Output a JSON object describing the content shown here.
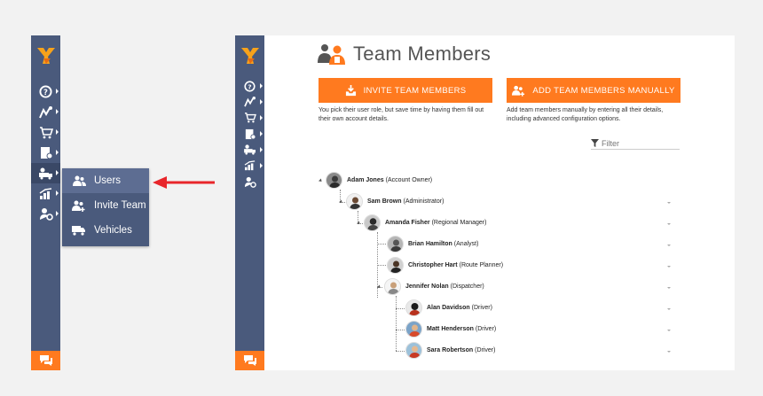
{
  "page": {
    "title": "Team Members"
  },
  "buttons": {
    "invite_label": "INVITE TEAM MEMBERS",
    "add_label": "ADD TEAM MEMBERS MANUALLY"
  },
  "descriptions": {
    "invite": "You pick their user role, but save time by having them fill out their own account details.",
    "add": "Add team members manually by entering all their details, including advanced configuration options."
  },
  "filter": {
    "placeholder": "Filter"
  },
  "flyout": {
    "items": [
      {
        "label": "Users",
        "icon": "users-icon"
      },
      {
        "label": "Invite Team",
        "icon": "invite-team-icon"
      },
      {
        "label": "Vehicles",
        "icon": "truck-icon"
      }
    ]
  },
  "tree": [
    {
      "name": "Adam Jones",
      "role": "(Account Owner)"
    },
    {
      "name": "Sam Brown",
      "role": "(Administrator)"
    },
    {
      "name": "Amanda Fisher",
      "role": "(Regional Manager)"
    },
    {
      "name": "Brian Hamilton",
      "role": "(Analyst)"
    },
    {
      "name": "Christopher Hart",
      "role": "(Route Planner)"
    },
    {
      "name": "Jennifer Nolan",
      "role": "(Dispatcher)"
    },
    {
      "name": "Alan Davidson",
      "role": "(Driver)"
    },
    {
      "name": "Matt Henderson",
      "role": "(Driver)"
    },
    {
      "name": "Sara Robertson",
      "role": "(Driver)"
    }
  ],
  "colors": {
    "sidebar": "#4a5a7c",
    "accent": "#ff7a1f",
    "arrow": "#e8262b"
  }
}
